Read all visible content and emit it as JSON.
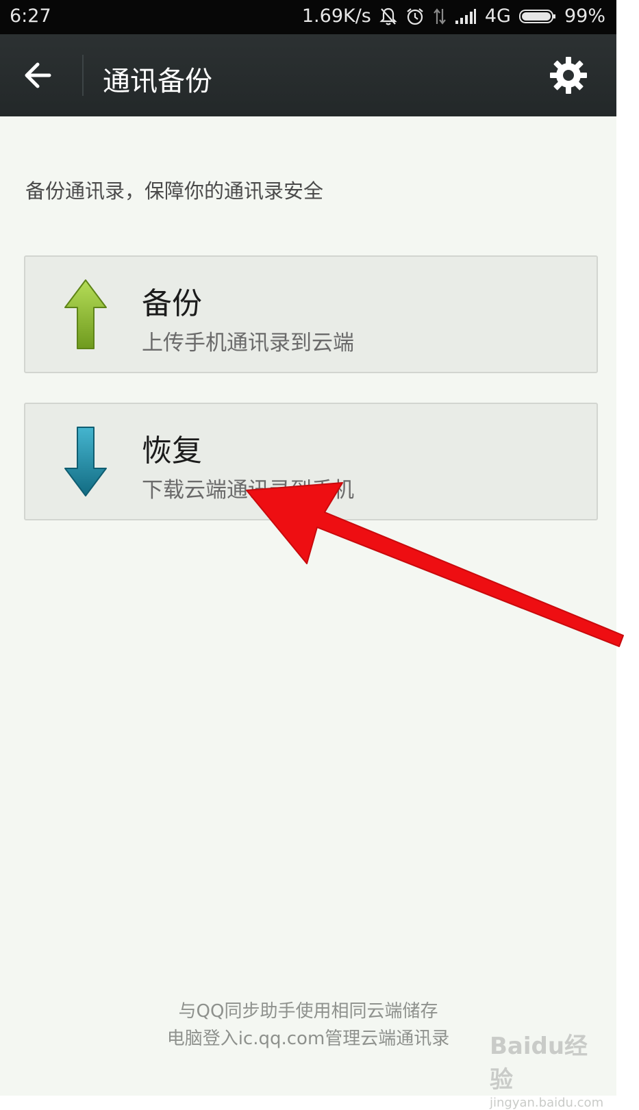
{
  "status_bar": {
    "time": "6:27",
    "net_speed": "1.69K/s",
    "network": "4G",
    "battery": "99%",
    "icons": [
      "bell-off-icon",
      "alarm-icon",
      "data-arrows-icon",
      "signal-icon",
      "battery-icon"
    ]
  },
  "app_bar": {
    "back_icon": "back-arrow-icon",
    "title": "通讯备份",
    "settings_icon": "gear-icon"
  },
  "description": "备份通讯录，保障你的通讯录安全",
  "actions": [
    {
      "title": "备份",
      "subtitle": "上传手机通讯录到云端",
      "icon": "up-arrow-icon",
      "color": "#8cbb2c"
    },
    {
      "title": "恢复",
      "subtitle": "下载云端通讯录到手机",
      "icon": "down-arrow-icon",
      "color": "#1f8aa3"
    }
  ],
  "footer": {
    "line1": "与QQ同步助手使用相同云端储存",
    "line2": "电脑登入ic.qq.com管理云端通讯录"
  },
  "watermark": {
    "line1": "Baidu经验",
    "line2": "jingyan.baidu.com"
  },
  "colors": {
    "app_bar": "#2a2f30",
    "background": "#f4f7f2",
    "annotation_arrow": "#ee0e12"
  }
}
